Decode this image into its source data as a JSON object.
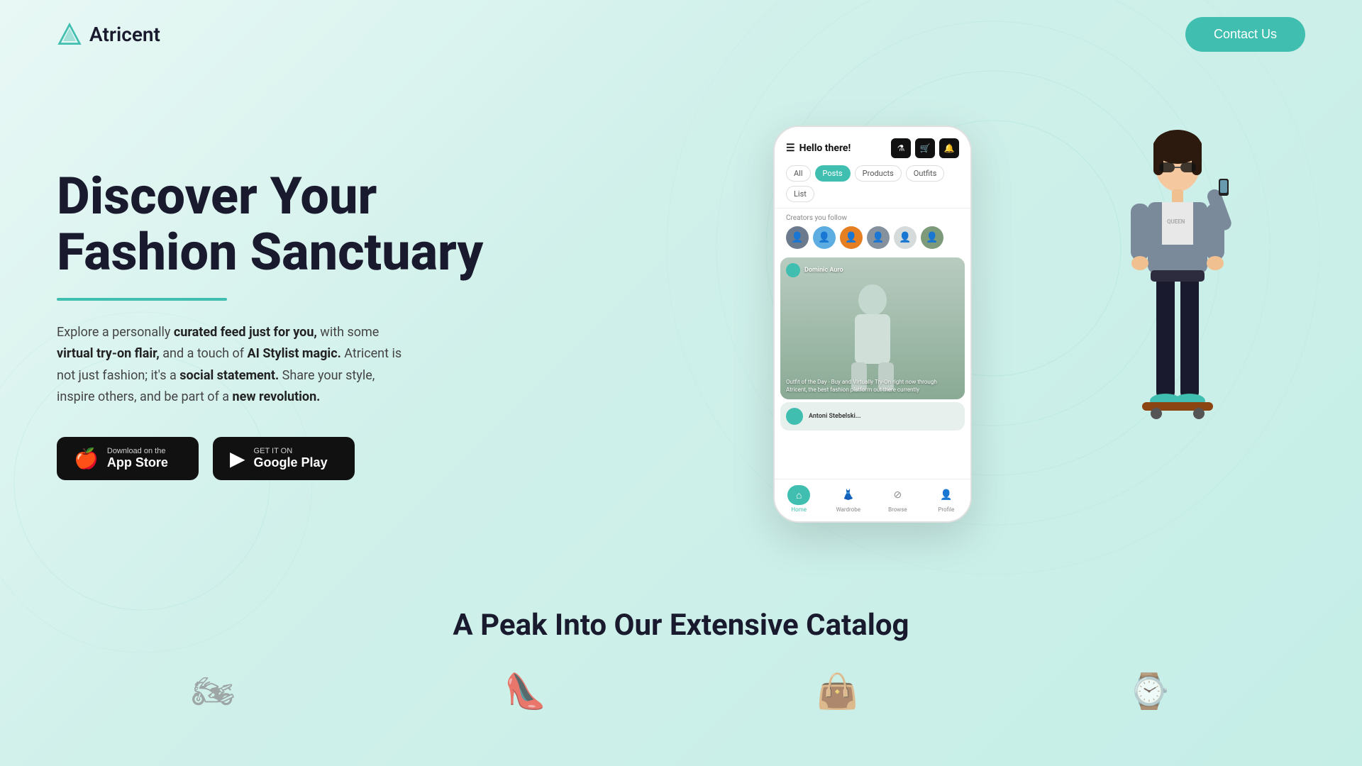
{
  "brand": {
    "name": "Atricent",
    "logo_symbol": "▲"
  },
  "header": {
    "contact_btn": "Contact Us"
  },
  "hero": {
    "title_line1": "Discover Your",
    "title_line2": "Fashion Sanctuary",
    "description_parts": [
      "Explore a personally ",
      "curated feed just for you,",
      " with some ",
      "virtual try-on flair,",
      " and a touch of ",
      "AI Stylist magic.",
      " Atricent is not just fashion; it's a ",
      "social statement.",
      " Share your style, inspire others, and be part of a ",
      "new revolution."
    ],
    "app_store_btn": {
      "sub": "Download on the",
      "main": "App Store",
      "icon": "🍎"
    },
    "google_play_btn": {
      "sub": "GET IT ON",
      "main": "Google Play",
      "icon": "▶"
    }
  },
  "phone": {
    "greeting": "Hello there!",
    "tabs": [
      "All",
      "Posts",
      "Products",
      "Outfits",
      "List"
    ],
    "active_tab": "Posts",
    "creators_label": "Creators you follow",
    "post1": {
      "username": "Dominic Auro",
      "caption": "Outfit of the Day - Buy and Virtually Try-On right now through Atricent, the best fashion platform out there currently"
    },
    "post2": {
      "username": "Antoni Stebelski..."
    },
    "nav_items": [
      "Home",
      "Wardrobe",
      "Browse",
      "Profile"
    ]
  },
  "catalog": {
    "heading": "A Peak Into Our Extensive Catalog"
  },
  "colors": {
    "teal": "#40bfb0",
    "dark": "#1a1a2e"
  }
}
